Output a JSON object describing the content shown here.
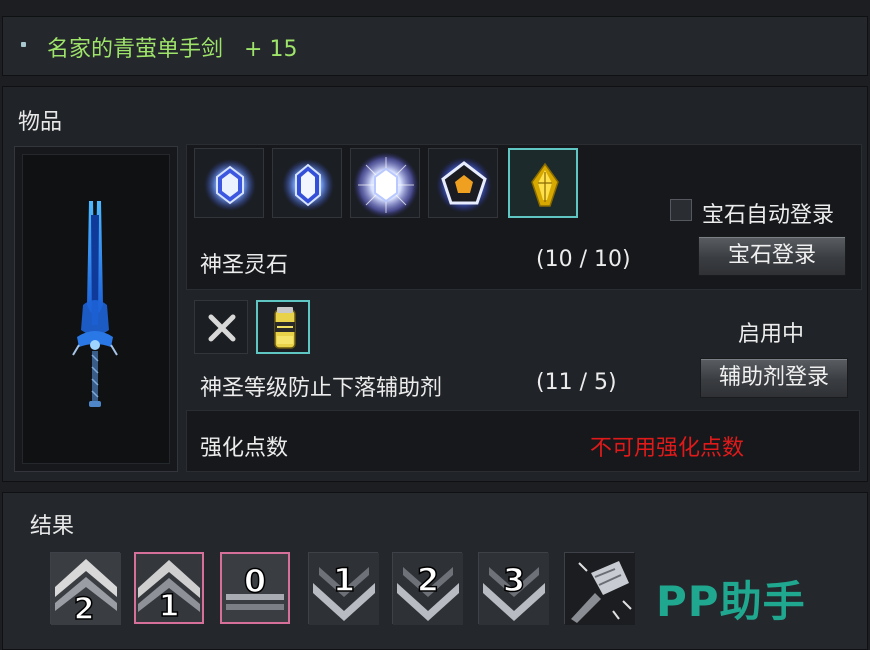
{
  "title": {
    "item_name": "名家的青萤单手剑",
    "enhance": "+ 15"
  },
  "item_section": {
    "label": "物品"
  },
  "gems": {
    "slots": [
      "gem-blue-icon",
      "gem-blue-icon",
      "gem-glow-icon",
      "gem-pentagon-icon",
      "gem-gold-icon"
    ],
    "name": "神圣灵石",
    "count": "(10  /  10)",
    "auto_register_label": "宝石自动登录",
    "register_button": "宝石登录"
  },
  "aux": {
    "name": "神圣等级防止下落辅助剂",
    "count": "(11  /  5)",
    "status": "启用中",
    "register_button": "辅助剂登录"
  },
  "points": {
    "label": "强化点数",
    "warning": "不可用强化点数",
    "warning_color": "#e01a1a"
  },
  "result": {
    "label": "结果",
    "tiles": [
      "2",
      "1",
      "0",
      "1",
      "2",
      "3"
    ]
  },
  "watermark": "PP助手"
}
